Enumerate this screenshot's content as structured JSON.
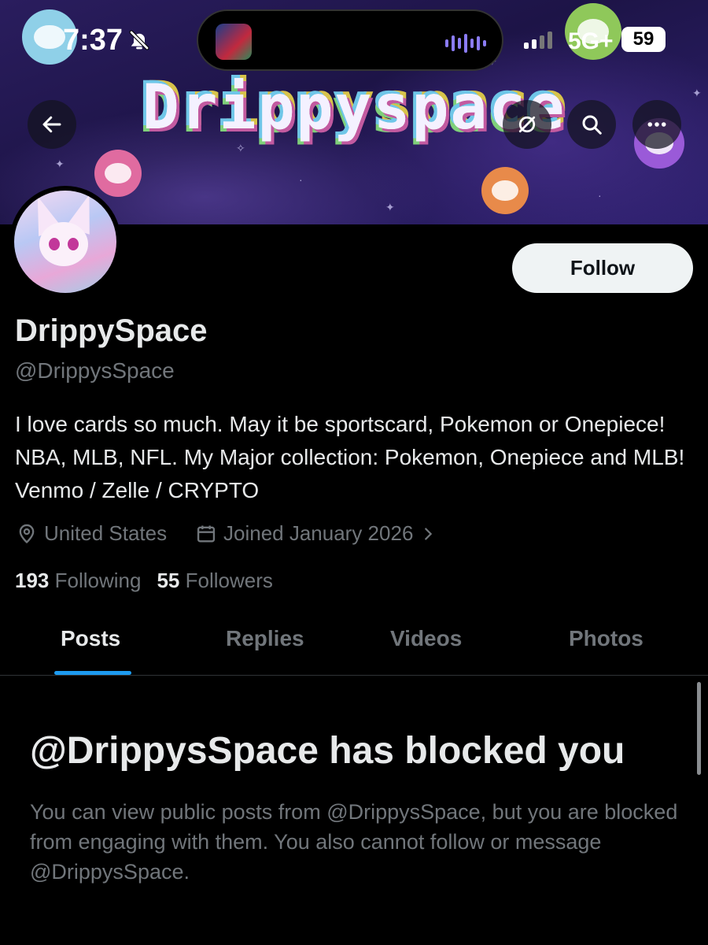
{
  "status_bar": {
    "time": "7:37",
    "network": "5G+",
    "battery": "59"
  },
  "banner": {
    "title": "Drippyspace"
  },
  "profile": {
    "display_name": "DrippySpace",
    "handle": "@DrippysSpace",
    "bio": "I love cards so much. May it be sportscard, Pokemon or Onepiece! NBA, MLB, NFL. My Major collection: Pokemon, Onepiece and MLB! Venmo / Zelle / CRYPTO",
    "location": "United States",
    "joined": "Joined January 2026",
    "following_count": "193",
    "following_label": "Following",
    "followers_count": "55",
    "followers_label": "Followers",
    "follow_label": "Follow"
  },
  "tabs": [
    {
      "label": "Posts",
      "active": true
    },
    {
      "label": "Replies",
      "active": false
    },
    {
      "label": "Videos",
      "active": false
    },
    {
      "label": "Photos",
      "active": false
    }
  ],
  "blocked": {
    "title": "@DrippysSpace has blocked you",
    "description": "You can view public posts from @DrippysSpace, but you are blocked from engaging with them. You also cannot follow or message @DrippysSpace."
  },
  "icons": {
    "back": "arrow-left-icon",
    "mute": "eye-slash-icon",
    "search": "search-icon",
    "more": "more-icon",
    "location": "location-pin-icon",
    "calendar": "calendar-icon",
    "chevron": "chevron-right-icon",
    "bell": "bell-slash-icon"
  },
  "colors": {
    "accent": "#1d9bf0",
    "background": "#000000",
    "secondary_text": "#71767b"
  }
}
